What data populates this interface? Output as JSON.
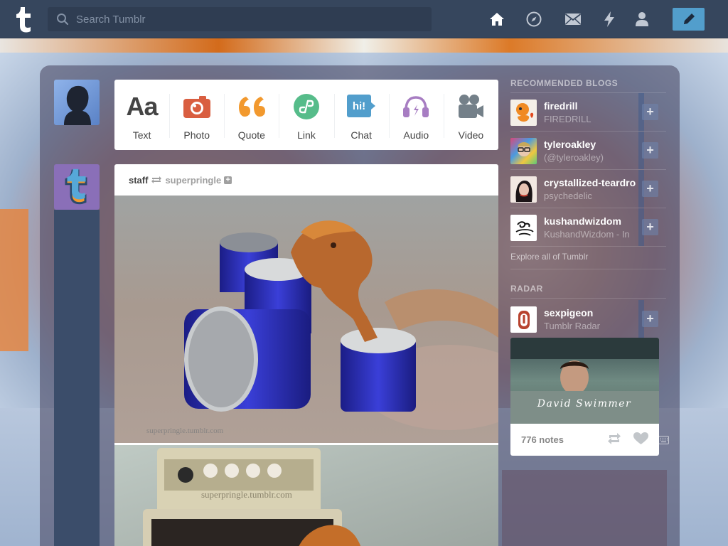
{
  "search": {
    "placeholder": "Search Tumblr"
  },
  "nav": {
    "icons": [
      "home-icon",
      "explore-compass-icon",
      "inbox-mail-icon",
      "activity-lightning-icon",
      "account-person-icon",
      "compose-pencil-icon"
    ]
  },
  "post_types": [
    {
      "label": "Text",
      "icon": "text-aa-icon",
      "color": "#444444"
    },
    {
      "label": "Photo",
      "icon": "camera-icon",
      "color": "#d95e40"
    },
    {
      "label": "Quote",
      "icon": "quote-icon",
      "color": "#f2992e"
    },
    {
      "label": "Link",
      "icon": "link-icon",
      "color": "#56bc8a"
    },
    {
      "label": "Chat",
      "icon": "chat-bubble-icon",
      "color": "#529ecc",
      "icon_text": "hi!"
    },
    {
      "label": "Audio",
      "icon": "headphones-icon",
      "color": "#a77dc2"
    },
    {
      "label": "Video",
      "icon": "video-camera-icon",
      "color": "#748089"
    }
  ],
  "post": {
    "author": "staff",
    "reblogged_from": "superpringle",
    "watermark": "superpringle.tumblr.com"
  },
  "sidebar": {
    "recommended_title": "RECOMMENDED BLOGS",
    "blogs": [
      {
        "name": "firedrill",
        "title": "FIREDRILL"
      },
      {
        "name": "tyleroakley",
        "title": "(@tyleroakley)"
      },
      {
        "name": "crystallized-teardro",
        "title": "psychedelic"
      },
      {
        "name": "kushandwizdom",
        "title": "KushandWizdom - In"
      }
    ],
    "explore_link": "Explore all of Tumblr",
    "radar_title": "RADAR",
    "radar_blog": {
      "name": "sexpigeon",
      "title": "Tumblr Radar"
    },
    "radar_caption": "David Swimmer",
    "radar_notes": "776 notes"
  },
  "colors": {
    "topbar": "#36465d",
    "accent": "#529ecc",
    "photo": "#d95e40",
    "quote": "#f2992e",
    "link": "#56bc8a",
    "audio": "#a77dc2",
    "video": "#748089"
  }
}
